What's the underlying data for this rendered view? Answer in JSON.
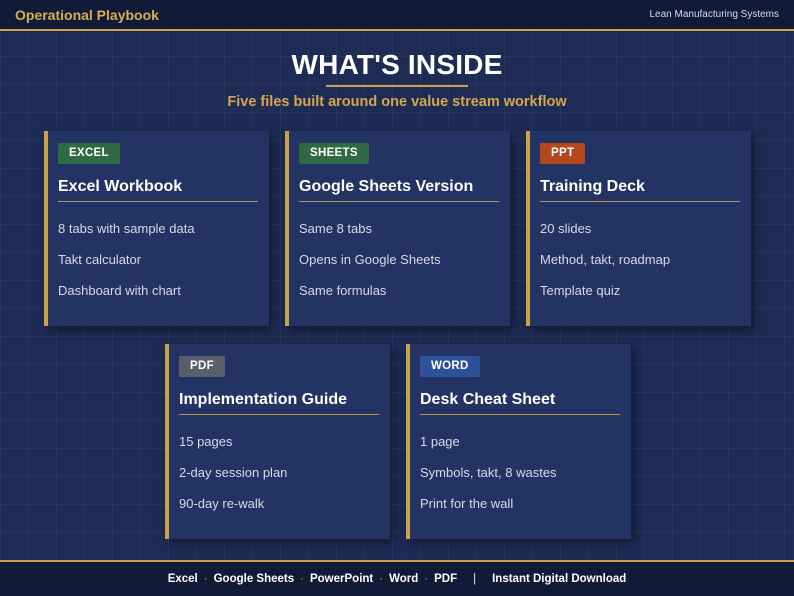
{
  "header": {
    "brand": "Operational Playbook",
    "tagline": "Lean Manufacturing Systems"
  },
  "hero": {
    "title": "WHAT'S INSIDE",
    "subtitle": "Five files built around one value stream workflow"
  },
  "cards": [
    {
      "badge": "EXCEL",
      "badge_color": "#2f6a43",
      "title": "Excel Workbook",
      "items": [
        "8 tabs with sample data",
        "Takt calculator",
        "Dashboard with chart"
      ]
    },
    {
      "badge": "SHEETS",
      "badge_color": "#2f6a43",
      "title": "Google Sheets Version",
      "items": [
        "Same 8 tabs",
        "Opens in Google Sheets",
        "Same formulas"
      ]
    },
    {
      "badge": "PPT",
      "badge_color": "#b5471c",
      "title": "Training Deck",
      "items": [
        "20 slides",
        "Method, takt, roadmap",
        "Template quiz"
      ]
    },
    {
      "badge": "PDF",
      "badge_color": "#5a5f6b",
      "title": "Implementation Guide",
      "items": [
        "15 pages",
        "2-day session plan",
        "90-day re-walk"
      ]
    },
    {
      "badge": "WORD",
      "badge_color": "#2e5299",
      "title": "Desk Cheat Sheet",
      "items": [
        "1 page",
        "Symbols, takt, 8 wastes",
        "Print for the wall"
      ]
    }
  ],
  "footer": {
    "formats": [
      "Excel",
      "Google Sheets",
      "PowerPoint",
      "Word",
      "PDF"
    ],
    "separator": "|",
    "delivery": "Instant Digital Download"
  },
  "colors": {
    "accent": "#c9a24a",
    "background": "#1e2c55",
    "bar": "#111b37"
  }
}
